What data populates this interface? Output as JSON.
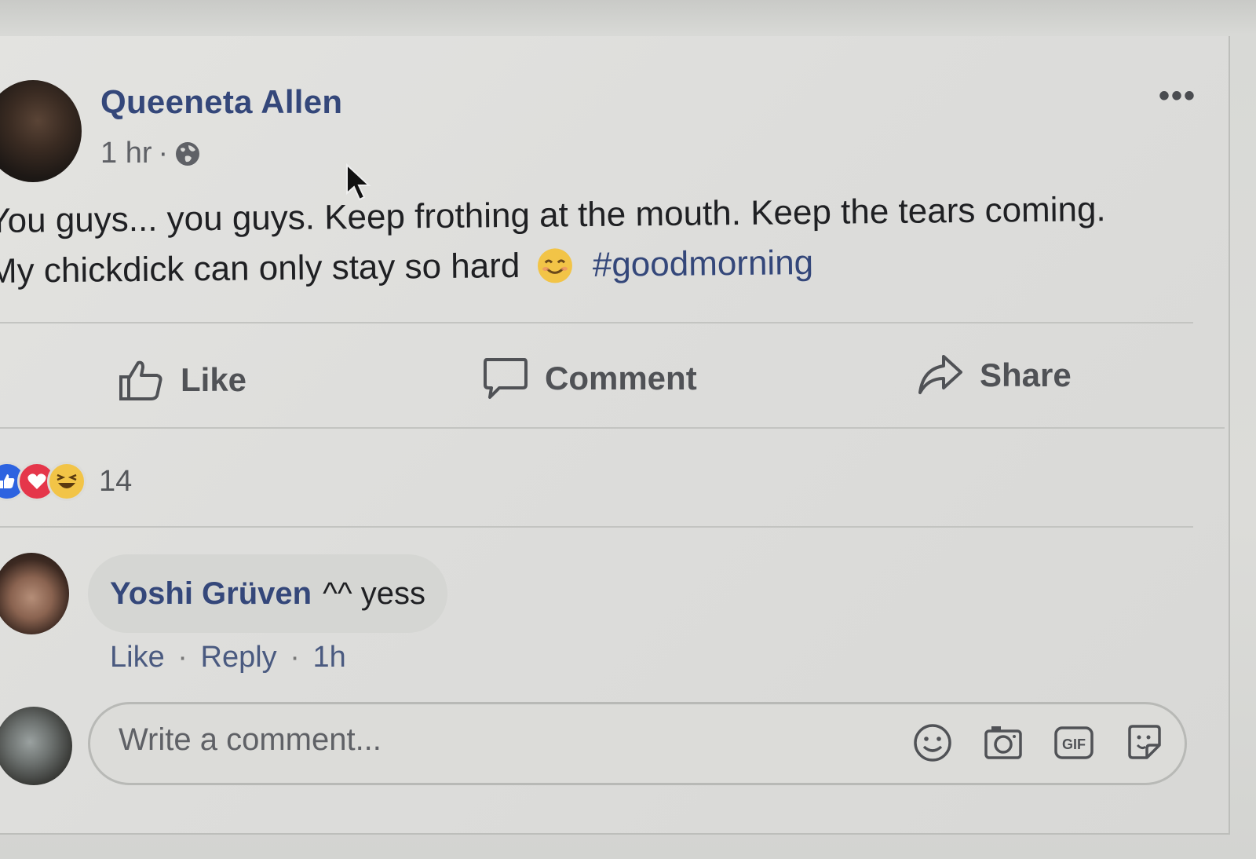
{
  "post": {
    "author": "Queeneta Allen",
    "time": "1 hr",
    "separator": "·",
    "privacy_icon": "globe-icon",
    "line1": "You guys... you guys. Keep frothing at the mouth. Keep the tears coming.",
    "line2_text": "My chickdick can only stay so hard",
    "emoji": "smiling-face-emoji",
    "hashtag": "#goodmorning",
    "more_icon": "more-options-icon"
  },
  "actions": {
    "like": "Like",
    "comment": "Comment",
    "share": "Share"
  },
  "reactions": {
    "icons": [
      "like-reaction-icon",
      "love-reaction-icon",
      "haha-reaction-icon"
    ],
    "count": "14"
  },
  "comment": {
    "author": "Yoshi Grüven",
    "text": "^^ yess",
    "like": "Like",
    "reply": "Reply",
    "time": "1h",
    "separator": "·"
  },
  "composer": {
    "placeholder": "Write a comment...",
    "icons": [
      "emoji-icon",
      "camera-icon",
      "gif-icon",
      "sticker-icon"
    ]
  },
  "colors": {
    "link_blue": "#34477a",
    "like_blue": "#2d63e0",
    "love_red": "#e5364a",
    "haha_yellow": "#f2c447"
  }
}
